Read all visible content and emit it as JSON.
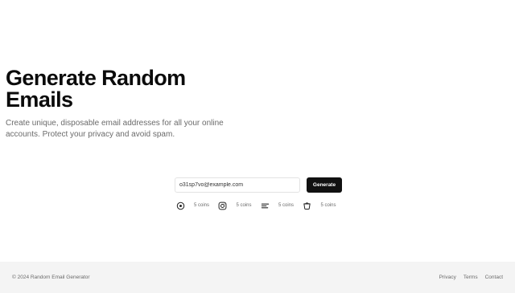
{
  "hero": {
    "title_line1": "Generate Random",
    "title_line2": "Emails",
    "subtitle": "Create unique, disposable email addresses for all your online accounts. Protect your privacy and avoid spam."
  },
  "generator": {
    "email_value": "o31sp7vo@example.com",
    "button_label": "Generate",
    "coins": [
      {
        "icon": "target-circle-icon",
        "label": "5 coins"
      },
      {
        "icon": "instagram-icon",
        "label": "5 coins"
      },
      {
        "icon": "text-lines-icon",
        "label": "5 coins"
      },
      {
        "icon": "basket-icon",
        "label": "5 coins"
      }
    ]
  },
  "footer": {
    "copyright": "© 2024 Random Email Generator",
    "links": [
      "Privacy",
      "Terms",
      "Contact"
    ]
  }
}
